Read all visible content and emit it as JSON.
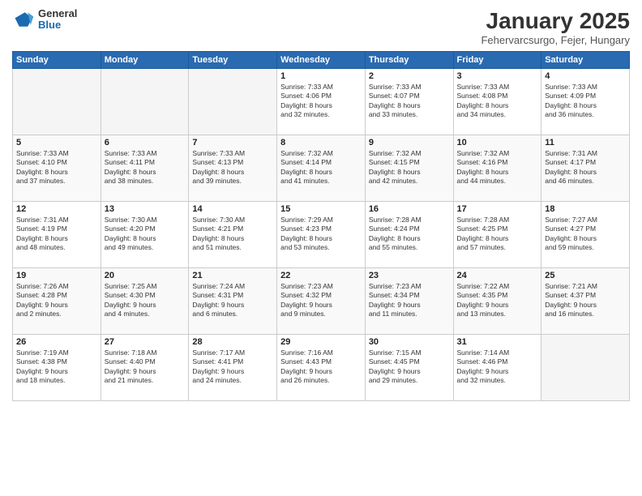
{
  "header": {
    "logo": {
      "general": "General",
      "blue": "Blue"
    },
    "title": "January 2025",
    "location": "Fehervarcsurgo, Fejer, Hungary"
  },
  "weekdays": [
    "Sunday",
    "Monday",
    "Tuesday",
    "Wednesday",
    "Thursday",
    "Friday",
    "Saturday"
  ],
  "weeks": [
    [
      {
        "day": "",
        "info": ""
      },
      {
        "day": "",
        "info": ""
      },
      {
        "day": "",
        "info": ""
      },
      {
        "day": "1",
        "info": "Sunrise: 7:33 AM\nSunset: 4:06 PM\nDaylight: 8 hours\nand 32 minutes."
      },
      {
        "day": "2",
        "info": "Sunrise: 7:33 AM\nSunset: 4:07 PM\nDaylight: 8 hours\nand 33 minutes."
      },
      {
        "day": "3",
        "info": "Sunrise: 7:33 AM\nSunset: 4:08 PM\nDaylight: 8 hours\nand 34 minutes."
      },
      {
        "day": "4",
        "info": "Sunrise: 7:33 AM\nSunset: 4:09 PM\nDaylight: 8 hours\nand 36 minutes."
      }
    ],
    [
      {
        "day": "5",
        "info": "Sunrise: 7:33 AM\nSunset: 4:10 PM\nDaylight: 8 hours\nand 37 minutes."
      },
      {
        "day": "6",
        "info": "Sunrise: 7:33 AM\nSunset: 4:11 PM\nDaylight: 8 hours\nand 38 minutes."
      },
      {
        "day": "7",
        "info": "Sunrise: 7:33 AM\nSunset: 4:13 PM\nDaylight: 8 hours\nand 39 minutes."
      },
      {
        "day": "8",
        "info": "Sunrise: 7:32 AM\nSunset: 4:14 PM\nDaylight: 8 hours\nand 41 minutes."
      },
      {
        "day": "9",
        "info": "Sunrise: 7:32 AM\nSunset: 4:15 PM\nDaylight: 8 hours\nand 42 minutes."
      },
      {
        "day": "10",
        "info": "Sunrise: 7:32 AM\nSunset: 4:16 PM\nDaylight: 8 hours\nand 44 minutes."
      },
      {
        "day": "11",
        "info": "Sunrise: 7:31 AM\nSunset: 4:17 PM\nDaylight: 8 hours\nand 46 minutes."
      }
    ],
    [
      {
        "day": "12",
        "info": "Sunrise: 7:31 AM\nSunset: 4:19 PM\nDaylight: 8 hours\nand 48 minutes."
      },
      {
        "day": "13",
        "info": "Sunrise: 7:30 AM\nSunset: 4:20 PM\nDaylight: 8 hours\nand 49 minutes."
      },
      {
        "day": "14",
        "info": "Sunrise: 7:30 AM\nSunset: 4:21 PM\nDaylight: 8 hours\nand 51 minutes."
      },
      {
        "day": "15",
        "info": "Sunrise: 7:29 AM\nSunset: 4:23 PM\nDaylight: 8 hours\nand 53 minutes."
      },
      {
        "day": "16",
        "info": "Sunrise: 7:28 AM\nSunset: 4:24 PM\nDaylight: 8 hours\nand 55 minutes."
      },
      {
        "day": "17",
        "info": "Sunrise: 7:28 AM\nSunset: 4:25 PM\nDaylight: 8 hours\nand 57 minutes."
      },
      {
        "day": "18",
        "info": "Sunrise: 7:27 AM\nSunset: 4:27 PM\nDaylight: 8 hours\nand 59 minutes."
      }
    ],
    [
      {
        "day": "19",
        "info": "Sunrise: 7:26 AM\nSunset: 4:28 PM\nDaylight: 9 hours\nand 2 minutes."
      },
      {
        "day": "20",
        "info": "Sunrise: 7:25 AM\nSunset: 4:30 PM\nDaylight: 9 hours\nand 4 minutes."
      },
      {
        "day": "21",
        "info": "Sunrise: 7:24 AM\nSunset: 4:31 PM\nDaylight: 9 hours\nand 6 minutes."
      },
      {
        "day": "22",
        "info": "Sunrise: 7:23 AM\nSunset: 4:32 PM\nDaylight: 9 hours\nand 9 minutes."
      },
      {
        "day": "23",
        "info": "Sunrise: 7:23 AM\nSunset: 4:34 PM\nDaylight: 9 hours\nand 11 minutes."
      },
      {
        "day": "24",
        "info": "Sunrise: 7:22 AM\nSunset: 4:35 PM\nDaylight: 9 hours\nand 13 minutes."
      },
      {
        "day": "25",
        "info": "Sunrise: 7:21 AM\nSunset: 4:37 PM\nDaylight: 9 hours\nand 16 minutes."
      }
    ],
    [
      {
        "day": "26",
        "info": "Sunrise: 7:19 AM\nSunset: 4:38 PM\nDaylight: 9 hours\nand 18 minutes."
      },
      {
        "day": "27",
        "info": "Sunrise: 7:18 AM\nSunset: 4:40 PM\nDaylight: 9 hours\nand 21 minutes."
      },
      {
        "day": "28",
        "info": "Sunrise: 7:17 AM\nSunset: 4:41 PM\nDaylight: 9 hours\nand 24 minutes."
      },
      {
        "day": "29",
        "info": "Sunrise: 7:16 AM\nSunset: 4:43 PM\nDaylight: 9 hours\nand 26 minutes."
      },
      {
        "day": "30",
        "info": "Sunrise: 7:15 AM\nSunset: 4:45 PM\nDaylight: 9 hours\nand 29 minutes."
      },
      {
        "day": "31",
        "info": "Sunrise: 7:14 AM\nSunset: 4:46 PM\nDaylight: 9 hours\nand 32 minutes."
      },
      {
        "day": "",
        "info": ""
      }
    ]
  ]
}
